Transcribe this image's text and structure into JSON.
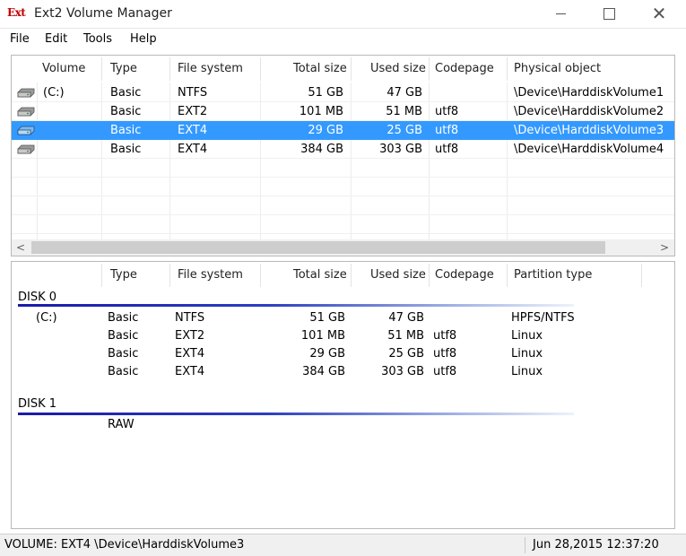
{
  "window": {
    "logo": "Ext",
    "title": "Ext2 Volume Manager",
    "minimize_icon": "minimize-icon",
    "maximize_icon": "maximize-icon",
    "close_icon": "close-icon",
    "close_glyph": "✕"
  },
  "menu": [
    "File",
    "Edit",
    "Tools",
    "Help"
  ],
  "volumes": {
    "headers": [
      "Volume",
      "Type",
      "File system",
      "Total size",
      "Used size",
      "Codepage",
      "Physical object"
    ],
    "rows": [
      {
        "volume": "(C:)",
        "type": "Basic",
        "fs": "NTFS",
        "total": "51 GB",
        "used": "47 GB",
        "codepage": "",
        "object": "\\Device\\HarddiskVolume1",
        "selected": false
      },
      {
        "volume": "",
        "type": "Basic",
        "fs": "EXT2",
        "total": "101 MB",
        "used": "51 MB",
        "codepage": "utf8",
        "object": "\\Device\\HarddiskVolume2",
        "selected": false
      },
      {
        "volume": "",
        "type": "Basic",
        "fs": "EXT4",
        "total": "29 GB",
        "used": "25 GB",
        "codepage": "utf8",
        "object": "\\Device\\HarddiskVolume3",
        "selected": true
      },
      {
        "volume": "",
        "type": "Basic",
        "fs": "EXT4",
        "total": "384 GB",
        "used": "303 GB",
        "codepage": "utf8",
        "object": "\\Device\\HarddiskVolume4",
        "selected": false
      }
    ],
    "scroll_left": "<",
    "scroll_right": ">"
  },
  "disks": {
    "headers": [
      "Type",
      "File system",
      "Total size",
      "Used size",
      "Codepage",
      "Partition type"
    ],
    "disk0": {
      "label": "DISK 0",
      "rows": [
        {
          "volume": "(C:)",
          "type": "Basic",
          "fs": "NTFS",
          "total": "51 GB",
          "used": "47 GB",
          "codepage": "",
          "ptype": "HPFS/NTFS"
        },
        {
          "volume": "",
          "type": "Basic",
          "fs": "EXT2",
          "total": "101 MB",
          "used": "51 MB",
          "codepage": "utf8",
          "ptype": "Linux"
        },
        {
          "volume": "",
          "type": "Basic",
          "fs": "EXT4",
          "total": "29 GB",
          "used": "25 GB",
          "codepage": "utf8",
          "ptype": "Linux"
        },
        {
          "volume": "",
          "type": "Basic",
          "fs": "EXT4",
          "total": "384 GB",
          "used": "303 GB",
          "codepage": "utf8",
          "ptype": "Linux"
        }
      ]
    },
    "disk1": {
      "label": "DISK 1",
      "rows": [
        {
          "type": "RAW"
        }
      ]
    }
  },
  "status": {
    "left": "VOLUME:  EXT4 \\Device\\HarddiskVolume3",
    "right": "Jun 28,2015 12:37:20"
  },
  "colors": {
    "selection": "#3399ff",
    "disk_line": "#1a1aa8"
  }
}
